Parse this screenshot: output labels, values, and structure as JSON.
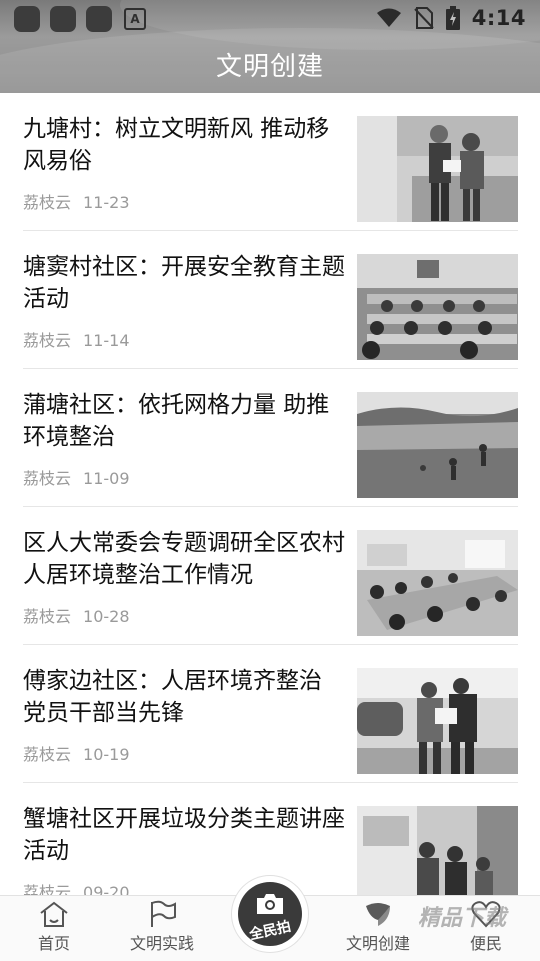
{
  "status_bar": {
    "time": "4:14",
    "notif_letter": "A"
  },
  "header": {
    "title": "文明创建"
  },
  "articles": [
    {
      "title": "九塘村：树立文明新风 推动移风易俗",
      "source": "荔枝云",
      "date": "11-23"
    },
    {
      "title": "塘窦村社区：开展安全教育主题活动",
      "source": "荔枝云",
      "date": "11-14"
    },
    {
      "title": "蒲塘社区：依托网格力量 助推环境整治",
      "source": "荔枝云",
      "date": "11-09"
    },
    {
      "title": "区人大常委会专题调研全区农村人居环境整治工作情况",
      "source": "荔枝云",
      "date": "10-28"
    },
    {
      "title": "傅家边社区：人居环境齐整治 党员干部当先锋",
      "source": "荔枝云",
      "date": "10-19"
    },
    {
      "title": "蟹塘社区开展垃圾分类主题讲座活动",
      "source": "荔枝云",
      "date": "09-20"
    }
  ],
  "bottom_nav": {
    "home": "首页",
    "practice": "文明实践",
    "camera": "全民拍",
    "creation": "文明创建",
    "service": "便民"
  },
  "watermark": "精品下载"
}
